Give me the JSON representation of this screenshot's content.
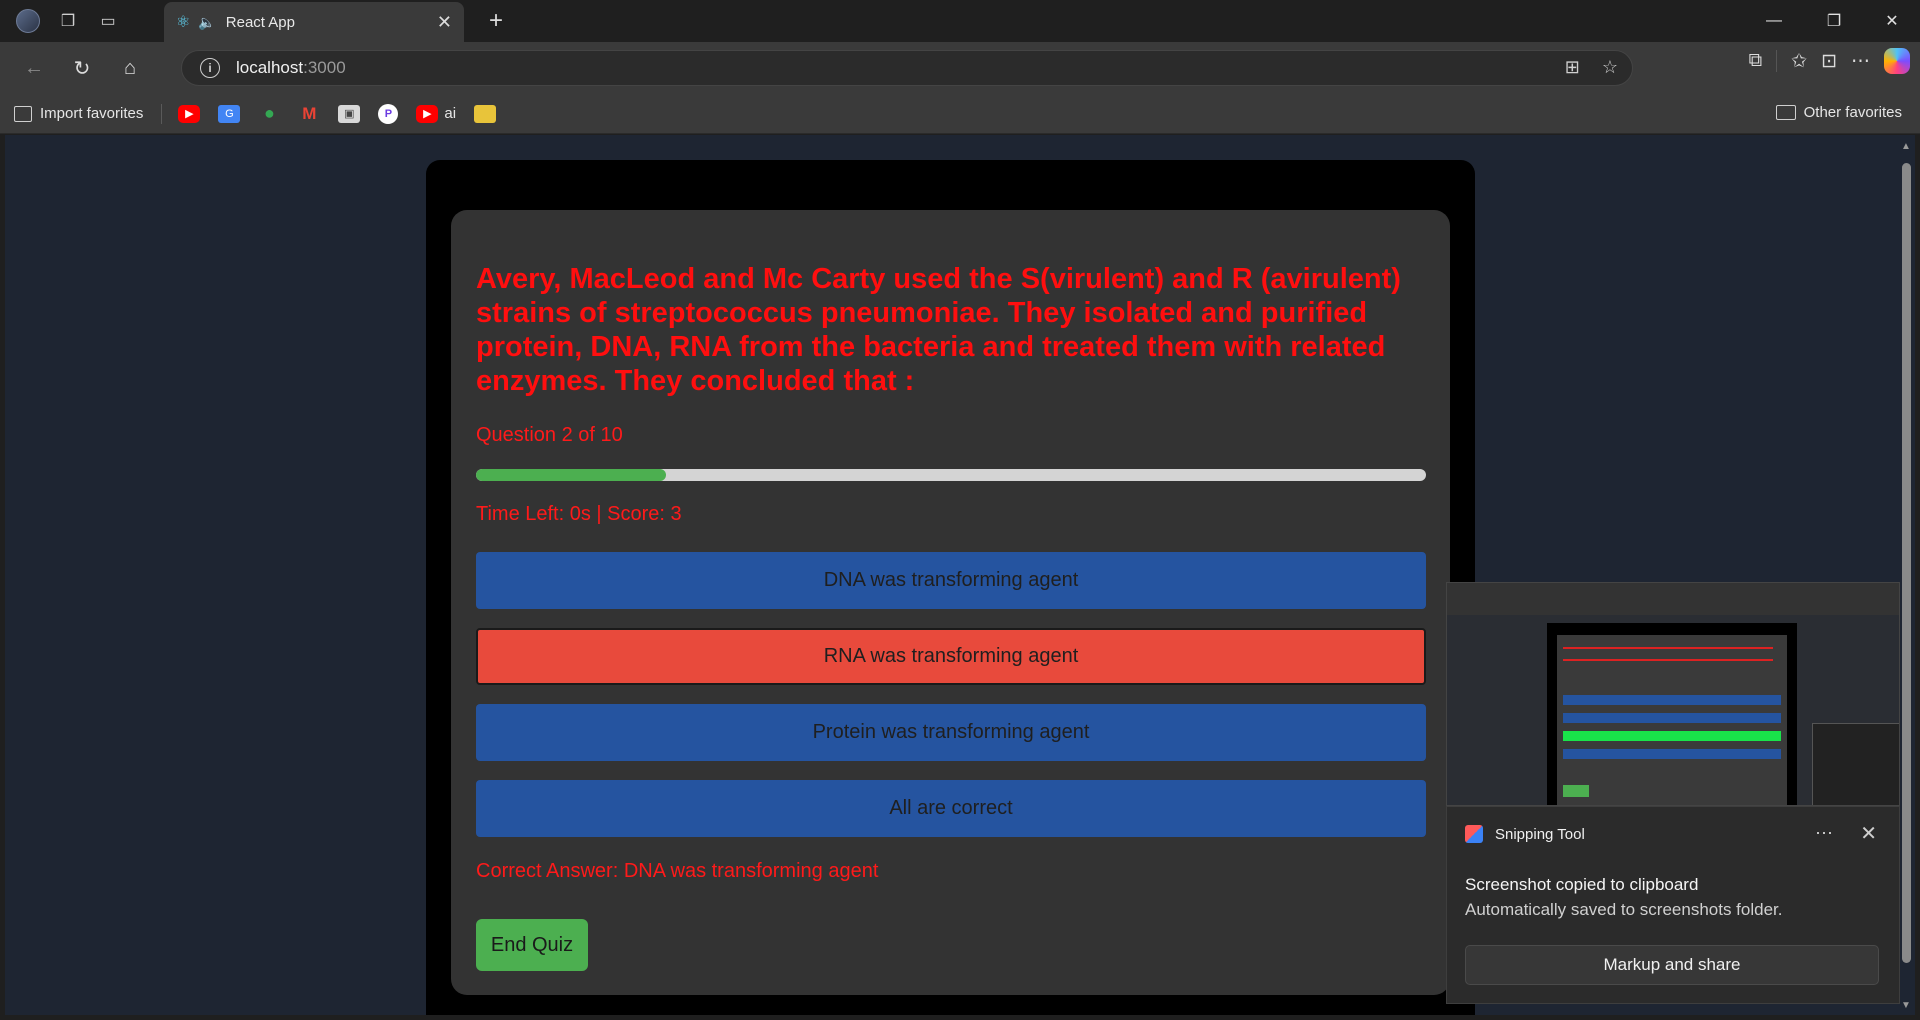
{
  "browser": {
    "tab_title": "React App",
    "url_host": "localhost",
    "url_port": ":3000",
    "favorites": {
      "import_label": "Import favorites",
      "ai_label": "ai",
      "other_label": "Other favorites"
    }
  },
  "quiz": {
    "question": "Avery, MacLeod and Mc Carty used the S(virulent) and R (avirulent) strains of streptococcus pneumoniae. They isolated and purified protein, DNA, RNA from the bacteria and treated them with related enzymes. They concluded that :",
    "question_counter": "Question 2 of 10",
    "progress_fraction": 0.2,
    "status": "Time Left: 0s | Score: 3",
    "options": [
      {
        "label": "DNA was transforming agent",
        "state": "default"
      },
      {
        "label": "RNA was transforming agent",
        "state": "wrong"
      },
      {
        "label": "Protein was transforming agent",
        "state": "default"
      },
      {
        "label": "All are correct",
        "state": "default"
      }
    ],
    "correct_answer": "Correct Answer: DNA was transforming agent",
    "end_button": "End Quiz"
  },
  "toast": {
    "app_name": "Snipping Tool",
    "title": "Screenshot copied to clipboard",
    "subtitle": "Automatically saved to screenshots folder.",
    "action": "Markup and share"
  },
  "colors": {
    "question_text": "#ff0f0f",
    "option_blue": "#2554a0",
    "option_wrong": "#e84a3c",
    "progress_fill": "#4caf50",
    "end_button": "#4caf50"
  }
}
